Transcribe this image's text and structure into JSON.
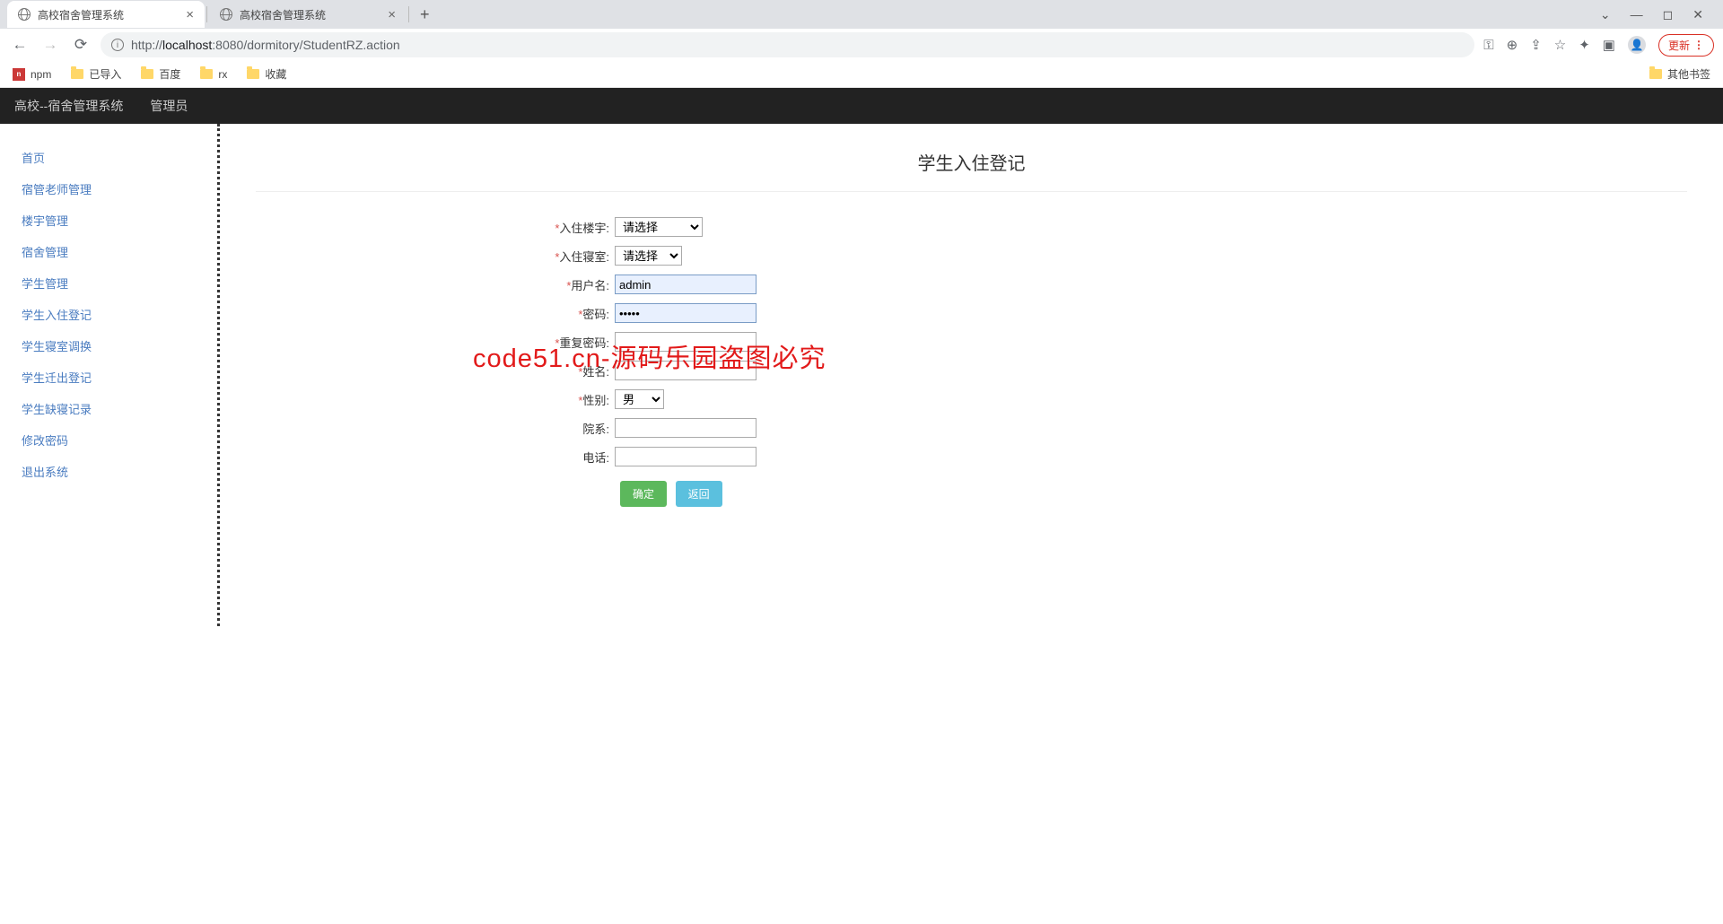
{
  "browser": {
    "tabs": [
      {
        "title": "高校宿舍管理系统",
        "active": true
      },
      {
        "title": "高校宿舍管理系统",
        "active": false
      }
    ],
    "url_prefix": "http://",
    "url_host": "localhost",
    "url_port": ":8080",
    "url_path": "/dormitory/StudentRZ.action",
    "update_label": "更新",
    "bookmarks": [
      "npm",
      "已导入",
      "百度",
      "rx",
      "收藏"
    ],
    "other_bookmarks": "其他书签"
  },
  "header": {
    "app_title": "高校--宿舍管理系统",
    "role": "管理员"
  },
  "sidebar": {
    "items": [
      "首页",
      "宿管老师管理",
      "楼宇管理",
      "宿舍管理",
      "学生管理",
      "学生入住登记",
      "学生寝室调换",
      "学生迁出登记",
      "学生缺寝记录",
      "修改密码",
      "退出系统"
    ]
  },
  "page": {
    "title": "学生入住登记",
    "watermark": "code51.cn-源码乐园盗图必究"
  },
  "form": {
    "building_label": "入住楼宇:",
    "building_option": "请选择",
    "room_label": "入住寝室:",
    "room_option": "请选择",
    "username_label": "用户名:",
    "username_value": "admin",
    "password_label": "密码:",
    "password_value": "•••••",
    "repassword_label": "重复密码:",
    "repassword_value": "",
    "name_label": "姓名:",
    "name_value": "",
    "gender_label": "性别:",
    "gender_option": "男",
    "dept_label": "院系:",
    "dept_value": "",
    "phone_label": "电话:",
    "phone_value": "",
    "submit": "确定",
    "back": "返回"
  }
}
